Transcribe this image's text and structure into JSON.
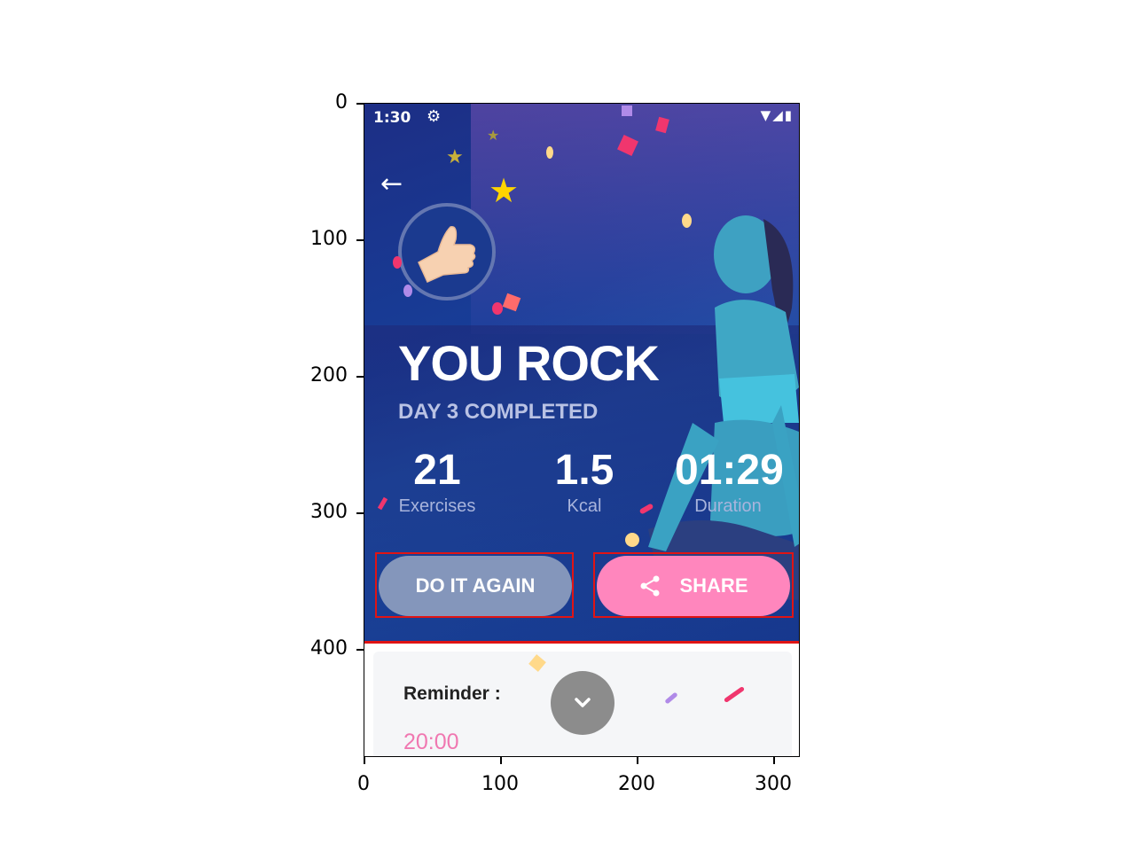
{
  "axes": {
    "y_ticks": [
      "0",
      "100",
      "200",
      "300",
      "400"
    ],
    "x_ticks": [
      "0",
      "100",
      "200",
      "300"
    ]
  },
  "status_bar": {
    "time": "1:30",
    "icons": [
      "gear-icon",
      "wifi-icon",
      "signal-icon",
      "battery-icon"
    ]
  },
  "header": {
    "back_icon": "arrow-left-icon"
  },
  "hero": {
    "title": "YOU ROCK",
    "subtitle": "DAY 3 COMPLETED",
    "badge_icon": "thumbs-up-icon"
  },
  "stats": [
    {
      "value": "21",
      "label": "Exercises"
    },
    {
      "value": "1.5",
      "label": "Kcal"
    },
    {
      "value": "01:29",
      "label": "Duration"
    }
  ],
  "actions": {
    "again_label": "DO IT AGAIN",
    "share_label": "SHARE",
    "share_icon": "share-icon"
  },
  "reminder": {
    "label": "Reminder :",
    "time": "20:00",
    "collapse_icon": "chevron-down-icon"
  },
  "colors": {
    "hero_bg": "#173d97",
    "accent_pink": "#ff86bd",
    "again_btn": "#8496bb",
    "reminder_time": "#f078b1",
    "annotation_red": "#e01414"
  }
}
